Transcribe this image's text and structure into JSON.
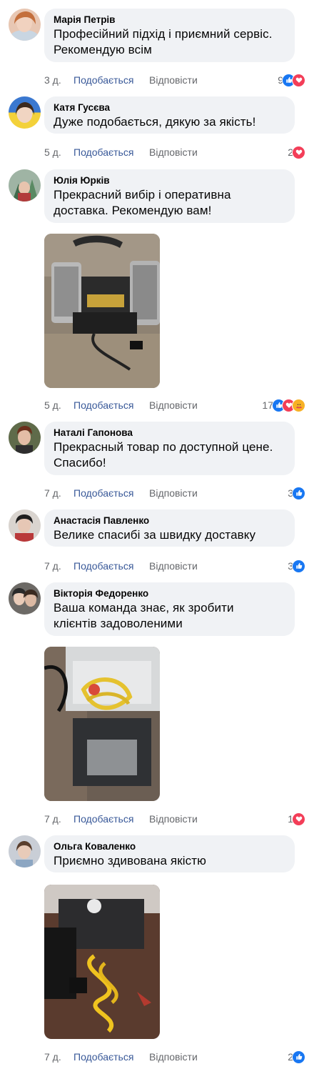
{
  "actions": {
    "like": "Подобається",
    "reply": "Відповісти"
  },
  "colors": {
    "like": "#1877f2",
    "love": "#f33e58",
    "care": "#f7b125",
    "link": "#385898"
  },
  "comments": [
    {
      "author": "Марія Петрів",
      "lines": [
        "Професійний підхід і приємний сервіс.",
        "Рекомендую всім"
      ],
      "time": "3 д.",
      "reactions_count": "9",
      "reactions": [
        "like-icon",
        "love-icon"
      ]
    },
    {
      "author": "Катя Гусєва",
      "lines": [
        "Дуже подобається, дякую за якість!"
      ],
      "time": "5 д.",
      "reactions_count": "2",
      "reactions": [
        "love-icon"
      ]
    },
    {
      "author": "Юлія Юрків",
      "lines": [
        "Прекрасний вибір і оперативна",
        "доставка. Рекомендую вам!"
      ],
      "time": "5 д.",
      "reactions_count": "17",
      "reactions": [
        "like-icon",
        "love-icon",
        "care-icon"
      ],
      "photo": "compressor-photo"
    },
    {
      "author": "Наталі Гапонова",
      "lines": [
        "Прекрасный товар по доступной цене.",
        "Спасибо!"
      ],
      "time": "7 д.",
      "reactions_count": "3",
      "reactions": [
        "like-icon"
      ]
    },
    {
      "author": "Анастасія Павленко",
      "lines": [
        "Велике спасибі за швидку доставку"
      ],
      "time": "7 д.",
      "reactions_count": "3",
      "reactions": [
        "like-icon"
      ]
    },
    {
      "author": "Вікторія Федоренко",
      "lines": [
        "Ваша команда знає, як зробити",
        "клієнтів задоволеними"
      ],
      "time": "7 д.",
      "reactions_count": "1",
      "reactions": [
        "love-icon"
      ],
      "photo": "compressor-photo"
    },
    {
      "author": "Ольга Коваленко",
      "lines": [
        "Приємно здивована якістю"
      ],
      "time": "7 д.",
      "reactions_count": "2",
      "reactions": [
        "like-icon"
      ],
      "photo": "compressor-photo"
    }
  ]
}
